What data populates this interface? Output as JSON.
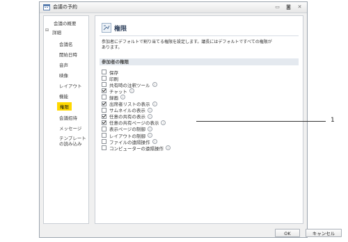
{
  "window": {
    "title": "会議の予約",
    "minimize": "▭",
    "maximize": "◙",
    "close": "✕"
  },
  "sidebar": {
    "expander": "⊟",
    "items": [
      {
        "label": "会議の概要"
      },
      {
        "label": "詳細"
      },
      {
        "label": "会議名"
      },
      {
        "label": "開始日時"
      },
      {
        "label": "音声"
      },
      {
        "label": "映像"
      },
      {
        "label": "レイアウト"
      },
      {
        "label": "機能"
      },
      {
        "label": "権限"
      },
      {
        "label": "会議招待"
      },
      {
        "label": "メッセージ"
      },
      {
        "label": "テンプレート"
      },
      {
        "label": "の読み込み"
      }
    ]
  },
  "main": {
    "title": "権限",
    "description_line1": "参加者にデフォルトで割り当てる権限を設定します。議長にはデフォルトですべての権限が",
    "description_line2": "あります。",
    "section_title": "参加者の権限",
    "permissions": [
      {
        "label": "保存",
        "checked": false,
        "info": false
      },
      {
        "label": "印刷",
        "checked": false,
        "info": false
      },
      {
        "label": "共有時の注釈ツール",
        "checked": false,
        "info": true
      },
      {
        "label": "チャット",
        "checked": true,
        "info": true
      },
      {
        "label": "録画",
        "checked": false,
        "info": true
      },
      {
        "label": "出席者リストの表示",
        "checked": true,
        "info": true
      },
      {
        "label": "サムネイルの表示",
        "checked": false,
        "info": true
      },
      {
        "label": "任意の共有の表示",
        "checked": true,
        "info": true
      },
      {
        "label": "任意の共有ページの表示",
        "checked": true,
        "info": true
      },
      {
        "label": "表示ページの制御",
        "checked": false,
        "info": true
      },
      {
        "label": "レイアウトの制御",
        "checked": false,
        "info": true
      },
      {
        "label": "ファイルの遠隔操作",
        "checked": false,
        "info": true
      },
      {
        "label": "コンピューターの遠隔操作",
        "checked": false,
        "info": true
      }
    ]
  },
  "footer": {
    "ok": "OK",
    "cancel": "キャンセル"
  },
  "callout": {
    "number": "1"
  },
  "info_glyph": "i"
}
